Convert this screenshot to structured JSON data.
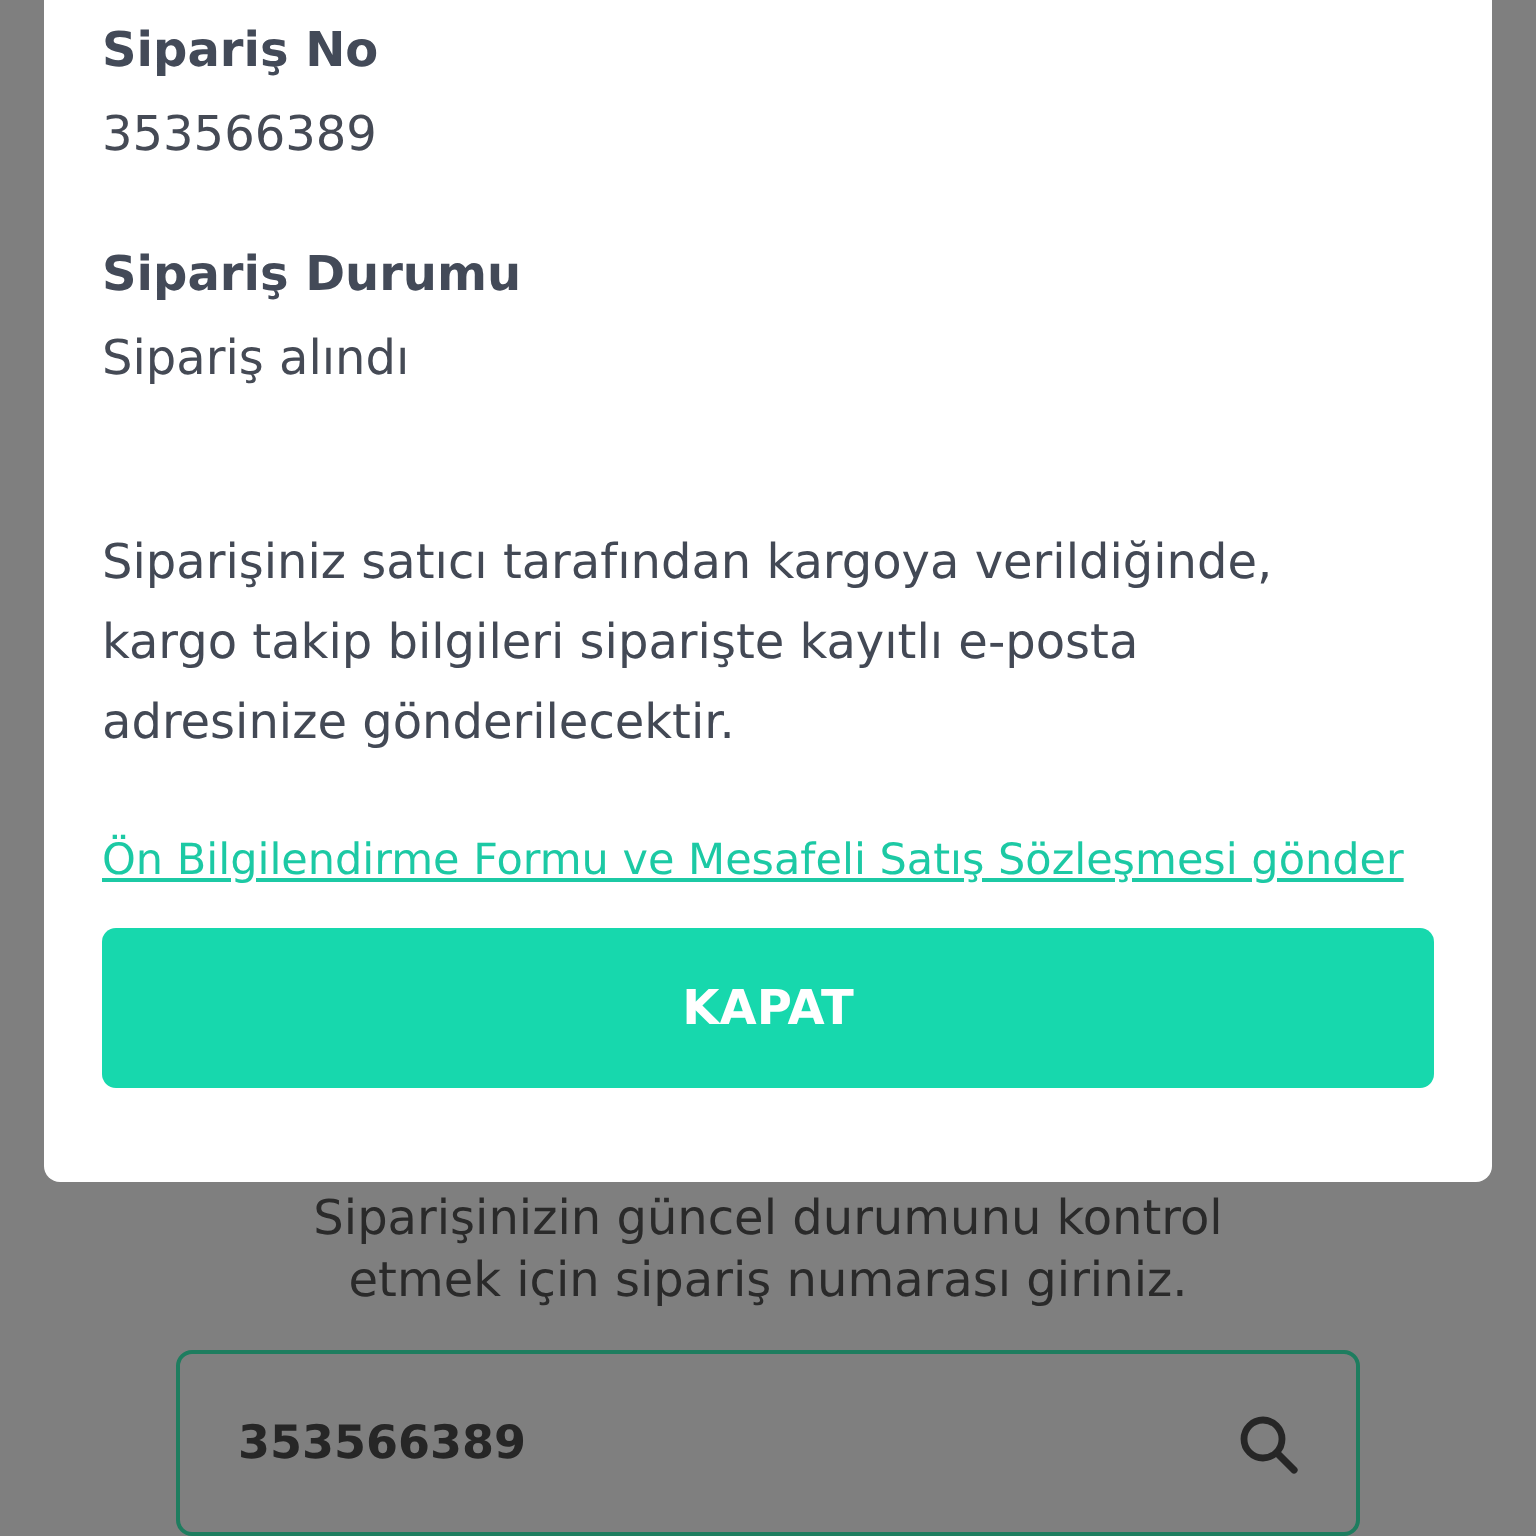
{
  "dialog": {
    "fields": [
      {
        "label": "Sipariş No",
        "value": "353566389"
      },
      {
        "label": "Sipariş Durumu",
        "value": "Sipariş alındı"
      }
    ],
    "message": "Siparişiniz satıcı tarafından kargoya verildiğinde, kargo takip bilgileri siparişte kayıtlı e-posta adresinize gönderilecektir.",
    "link": "Ön Bilgilendirme Formu ve Mesafeli Satış Sözleşmesi gönder",
    "button": "KAPAT"
  },
  "page": {
    "instruction": "Siparişinizin güncel durumunu kontrol etmek için sipariş numarası giriniz.",
    "search": {
      "value": "353566389"
    }
  }
}
